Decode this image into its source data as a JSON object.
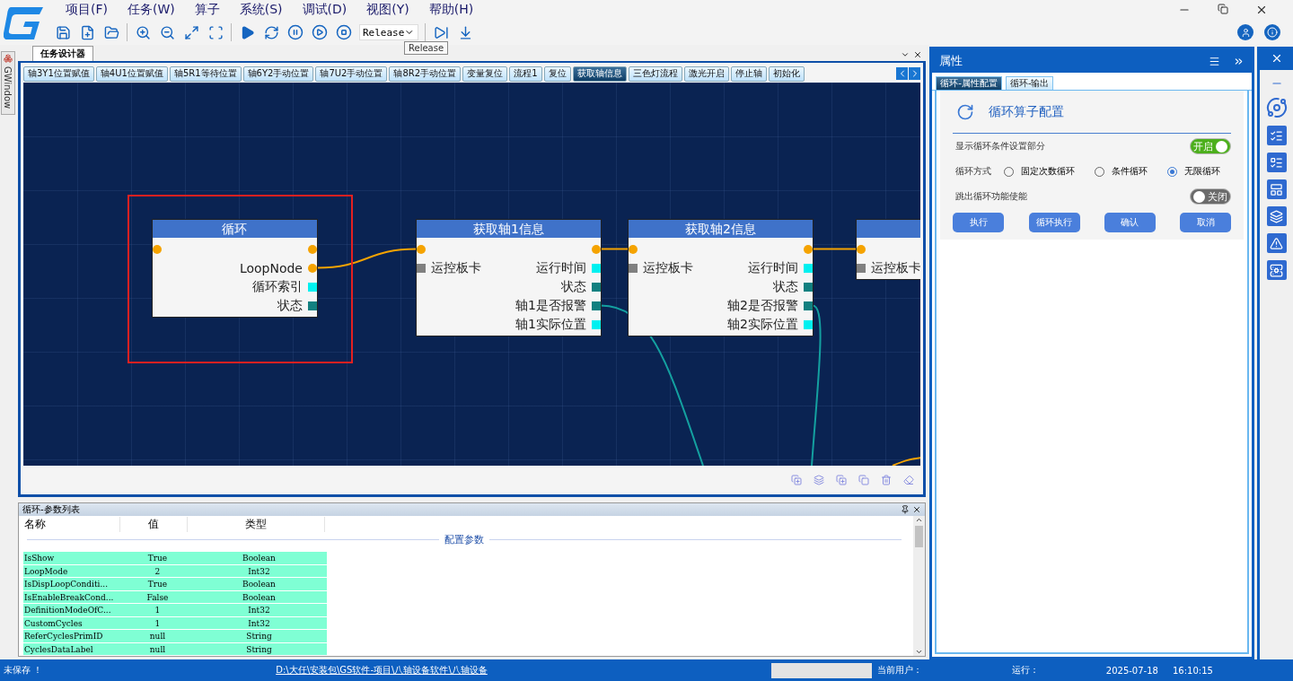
{
  "menu": [
    "项目(F)",
    "任务(W)",
    "算子",
    "系统(S)",
    "调试(D)",
    "视图(Y)",
    "帮助(H)"
  ],
  "toolbar": {
    "build_config": "Release",
    "tooltip": "Release"
  },
  "side_tab": "GWindow",
  "document": {
    "title": "任务设计器",
    "tabs": [
      {
        "label": "轴3Y1位置赋值",
        "selected": false
      },
      {
        "label": "轴4U1位置赋值",
        "selected": false
      },
      {
        "label": "轴5R1等待位置",
        "selected": false
      },
      {
        "label": "轴6Y2手动位置",
        "selected": false
      },
      {
        "label": "轴7U2手动位置",
        "selected": false
      },
      {
        "label": "轴8R2手动位置",
        "selected": false
      },
      {
        "label": "变量复位",
        "selected": false
      },
      {
        "label": "流程1",
        "selected": false
      },
      {
        "label": "复位",
        "selected": false
      },
      {
        "label": "获取轴信息",
        "selected": true
      },
      {
        "label": "三色灯流程",
        "selected": false
      },
      {
        "label": "激光开启",
        "selected": false
      },
      {
        "label": "停止轴",
        "selected": false
      },
      {
        "label": "初始化",
        "selected": false
      }
    ],
    "nodes": [
      {
        "title": "循环",
        "selected": true,
        "left": [
          {
            "kind": "flow"
          }
        ],
        "right": [
          {
            "kind": "flow"
          },
          {
            "kind": "flow",
            "label": "LoopNode"
          },
          {
            "kind": "value",
            "label": "循环索引"
          },
          {
            "kind": "status",
            "label": "状态"
          }
        ]
      },
      {
        "title": "获取轴1信息",
        "selected": false,
        "left": [
          {
            "kind": "flow"
          },
          {
            "kind": "object",
            "label": "运控板卡"
          }
        ],
        "right": [
          {
            "kind": "flow"
          },
          {
            "kind": "value",
            "label": "运行时间"
          },
          {
            "kind": "status",
            "label": "状态"
          },
          {
            "kind": "status",
            "label": "轴1是否报警"
          },
          {
            "kind": "value",
            "label": "轴1实际位置"
          }
        ]
      },
      {
        "title": "获取轴2信息",
        "selected": false,
        "left": [
          {
            "kind": "flow"
          },
          {
            "kind": "object",
            "label": "运控板卡"
          }
        ],
        "right": [
          {
            "kind": "flow"
          },
          {
            "kind": "value",
            "label": "运行时间"
          },
          {
            "kind": "status",
            "label": "状态"
          },
          {
            "kind": "status",
            "label": "轴2是否报警"
          },
          {
            "kind": "value",
            "label": "轴2实际位置"
          }
        ]
      },
      {
        "selected": false,
        "left": [
          {
            "kind": "flow"
          },
          {
            "kind": "object",
            "label": "运控板卡"
          }
        ]
      }
    ]
  },
  "params": {
    "title": "循环-参数列表",
    "columns": [
      "名称",
      "值",
      "类型"
    ],
    "group": "配置参数",
    "rows": [
      [
        "IsShow",
        "True",
        "Boolean"
      ],
      [
        "LoopMode",
        "2",
        "Int32"
      ],
      [
        "IsDispLoopConditi...",
        "True",
        "Boolean"
      ],
      [
        "IsEnableBreakCond...",
        "False",
        "Boolean"
      ],
      [
        "DefinitionModeOfC...",
        "1",
        "Int32"
      ],
      [
        "CustomCycles",
        "1",
        "Int32"
      ],
      [
        "ReferCyclesPrimID",
        "null",
        "String"
      ],
      [
        "CyclesDataLabel",
        "null",
        "String"
      ]
    ]
  },
  "properties": {
    "title": "属性",
    "tabs": [
      {
        "label": "循环-属性配置",
        "selected": true
      },
      {
        "label": "循环-输出",
        "selected": false
      }
    ],
    "heading": "循环算子配置",
    "show_condition": {
      "label": "显示循环条件设置部分",
      "on": true,
      "state_label": "开启"
    },
    "loop_mode": {
      "label": "循环方式",
      "options": [
        {
          "label": "固定次数循环",
          "selected": false
        },
        {
          "label": "条件循环",
          "selected": false
        },
        {
          "label": "无限循环",
          "selected": true
        }
      ]
    },
    "break_enable": {
      "label": "跳出循环功能使能",
      "on": false,
      "state_label": "关闭"
    },
    "buttons": [
      "执行",
      "循环执行",
      "确认",
      "取消"
    ]
  },
  "status_bar": {
    "save_state": "未保存 ！",
    "path": "D:\\大任\\安装包\\GS软件-项目\\八轴设备软件\\八轴设备",
    "user_label": "当前用户：",
    "run_label": "运行：",
    "date": "2025-07-18",
    "time": "16:10:15"
  }
}
